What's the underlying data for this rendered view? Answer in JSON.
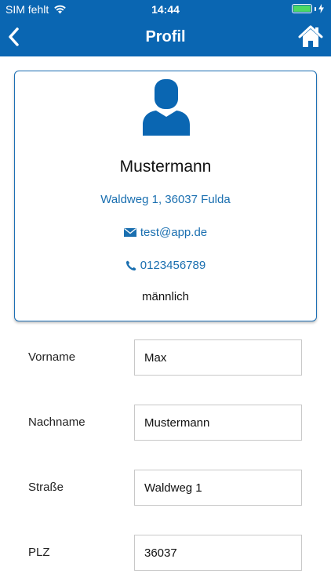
{
  "status_bar": {
    "carrier": "SIM fehlt",
    "time": "14:44",
    "battery_color": "#4cd964"
  },
  "nav": {
    "title": "Profil",
    "back_icon": "chevron-left-icon",
    "home_icon": "home-icon",
    "bar_color": "#0a66b2"
  },
  "profile_card": {
    "avatar_icon": "person-icon",
    "name": "Mustermann",
    "address": "Waldweg 1, 36037 Fulda",
    "email": "test@app.de",
    "phone": "0123456789",
    "gender": "männlich",
    "link_color": "#1a6fb0"
  },
  "form": {
    "fields": [
      {
        "label": "Vorname",
        "value": "Max"
      },
      {
        "label": "Nachname",
        "value": "Mustermann"
      },
      {
        "label": "Straße",
        "value": "Waldweg 1"
      },
      {
        "label": "PLZ",
        "value": "36037"
      }
    ]
  }
}
